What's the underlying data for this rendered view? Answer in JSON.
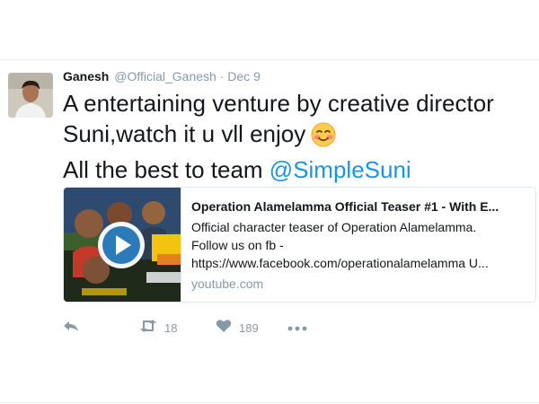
{
  "tweet": {
    "author_name": "Ganesh",
    "handle": "@Official_Ganesh",
    "separator": "·",
    "date": "Dec 9",
    "text_line1": "A entertaining venture by creative director",
    "text_line2": "Suni,watch it u vll enjoy",
    "text_line3_prefix": "All the best to team ",
    "mention": "@SimpleSuni"
  },
  "card": {
    "title": "Operation Alamelamma Official Teaser #1 - With E...",
    "desc_line1": "Official character teaser of Operation Alamelamma.",
    "desc_line2": "Follow us on fb -",
    "desc_line3": "https://www.facebook.com/operationalamelamma U...",
    "domain": "youtube.com"
  },
  "actions": {
    "retweet_count": "18",
    "like_count": "189"
  },
  "icons": {
    "reply": "reply-icon",
    "retweet": "retweet-icon",
    "like": "heart-icon",
    "more": "more-icon",
    "play": "play-icon",
    "emoji": "smiling-face-emoji"
  },
  "colors": {
    "mention": "#1b95e0",
    "muted": "#8899a6",
    "text": "#14171a",
    "border": "#e1e8ed"
  }
}
